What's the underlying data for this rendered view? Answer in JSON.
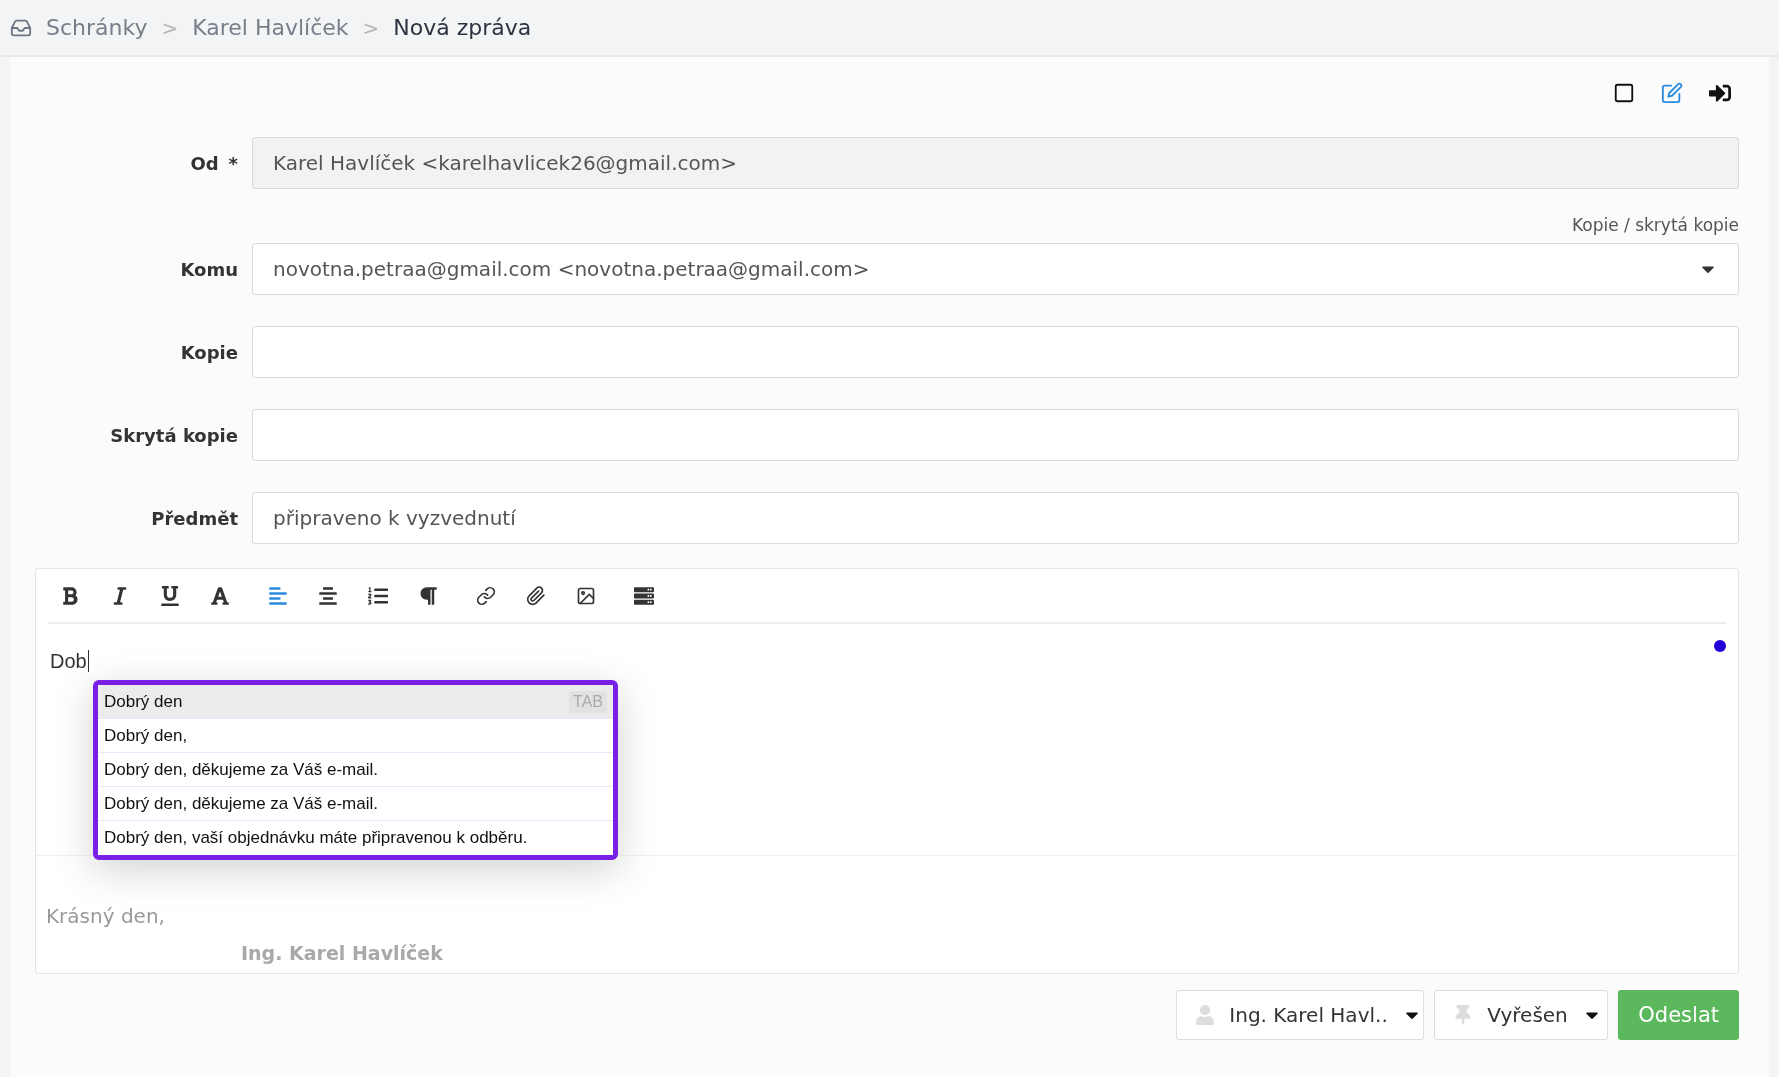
{
  "breadcrumb": {
    "items": [
      {
        "label": "Schránky",
        "current": false
      },
      {
        "label": "Karel Havlíček",
        "current": false
      },
      {
        "label": "Nová zpráva",
        "current": true
      }
    ],
    "separator": ">"
  },
  "fields": [
    {
      "label": "Od",
      "required": true,
      "value": "Karel Havlíček <karelhavlicek26@gmail.com>",
      "disabled": true,
      "kind": "text"
    },
    {
      "label": "Komu",
      "required": false,
      "value": "novotna.petraa@gmail.com <novotna.petraa@gmail.com>",
      "disabled": false,
      "kind": "select"
    },
    {
      "label": "Kopie",
      "required": false,
      "disabled": false,
      "kind": "text"
    },
    {
      "label": "Skrytá kopie",
      "required": false,
      "disabled": false,
      "kind": "text"
    },
    {
      "label": "Předmět",
      "required": false,
      "value": "připraveno k vyzvednutí",
      "disabled": false,
      "kind": "text"
    }
  ],
  "cc_link": "Kopie / skrytá kopie",
  "required_mark": "*",
  "editor": {
    "text": "Dob",
    "signature_greeting": "Krásný den,",
    "signature_name": "Ing. Karel Havlíček",
    "suggestions": [
      {
        "label": "Dobrý den",
        "selected": true
      },
      {
        "label": "Dobrý den,",
        "selected": false
      },
      {
        "label": "Dobrý den, děkujeme za Váš e-mail.",
        "selected": false
      },
      {
        "label": "Dobrý den, děkujeme za Váš e-mail.",
        "selected": false
      },
      {
        "label": "Dobrý den, vaší objednávku máte připravenou k odběru.",
        "selected": false
      }
    ],
    "suggestion_hint": "TAB"
  },
  "footer": {
    "sender": "Ing. Karel Havl..",
    "status": "Vyřešen",
    "send": "Odeslat"
  }
}
